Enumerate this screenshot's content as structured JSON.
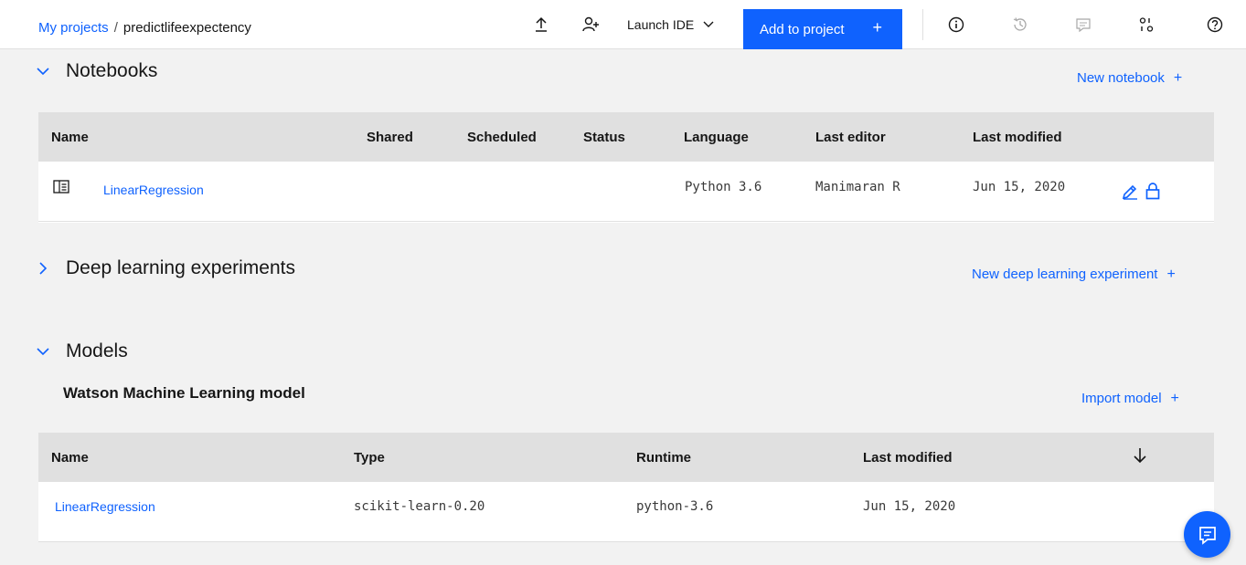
{
  "breadcrumb": {
    "root": "My projects",
    "separator": "/",
    "current": "predictlifeexpectency"
  },
  "toolbar": {
    "launch_ide": "Launch IDE",
    "add_to_project": "Add to project",
    "add_plus": "+"
  },
  "notebooks": {
    "title": "Notebooks",
    "new_label": "New notebook",
    "new_plus": "+",
    "columns": [
      "Name",
      "Shared",
      "Scheduled",
      "Status",
      "Language",
      "Last editor",
      "Last modified"
    ],
    "rows": [
      {
        "name": "LinearRegression",
        "language": "Python 3.6",
        "editor": "Manimaran R",
        "modified": "Jun 15, 2020"
      }
    ]
  },
  "experiments": {
    "title": "Deep learning experiments",
    "new_label": "New deep learning experiment",
    "new_plus": "+"
  },
  "models": {
    "title": "Models",
    "subtitle": "Watson Machine Learning model",
    "import_label": "Import model",
    "import_plus": "+",
    "columns": [
      "Name",
      "Type",
      "Runtime",
      "Last modified"
    ],
    "rows": [
      {
        "name": "LinearRegression",
        "type": "scikit-learn-0.20",
        "runtime": "python-3.6",
        "modified": "Jun 15, 2020"
      }
    ]
  },
  "colors": {
    "accent": "#0f62fe",
    "header_row": "#e0e0e0",
    "page_bg": "#f2f2f2"
  }
}
